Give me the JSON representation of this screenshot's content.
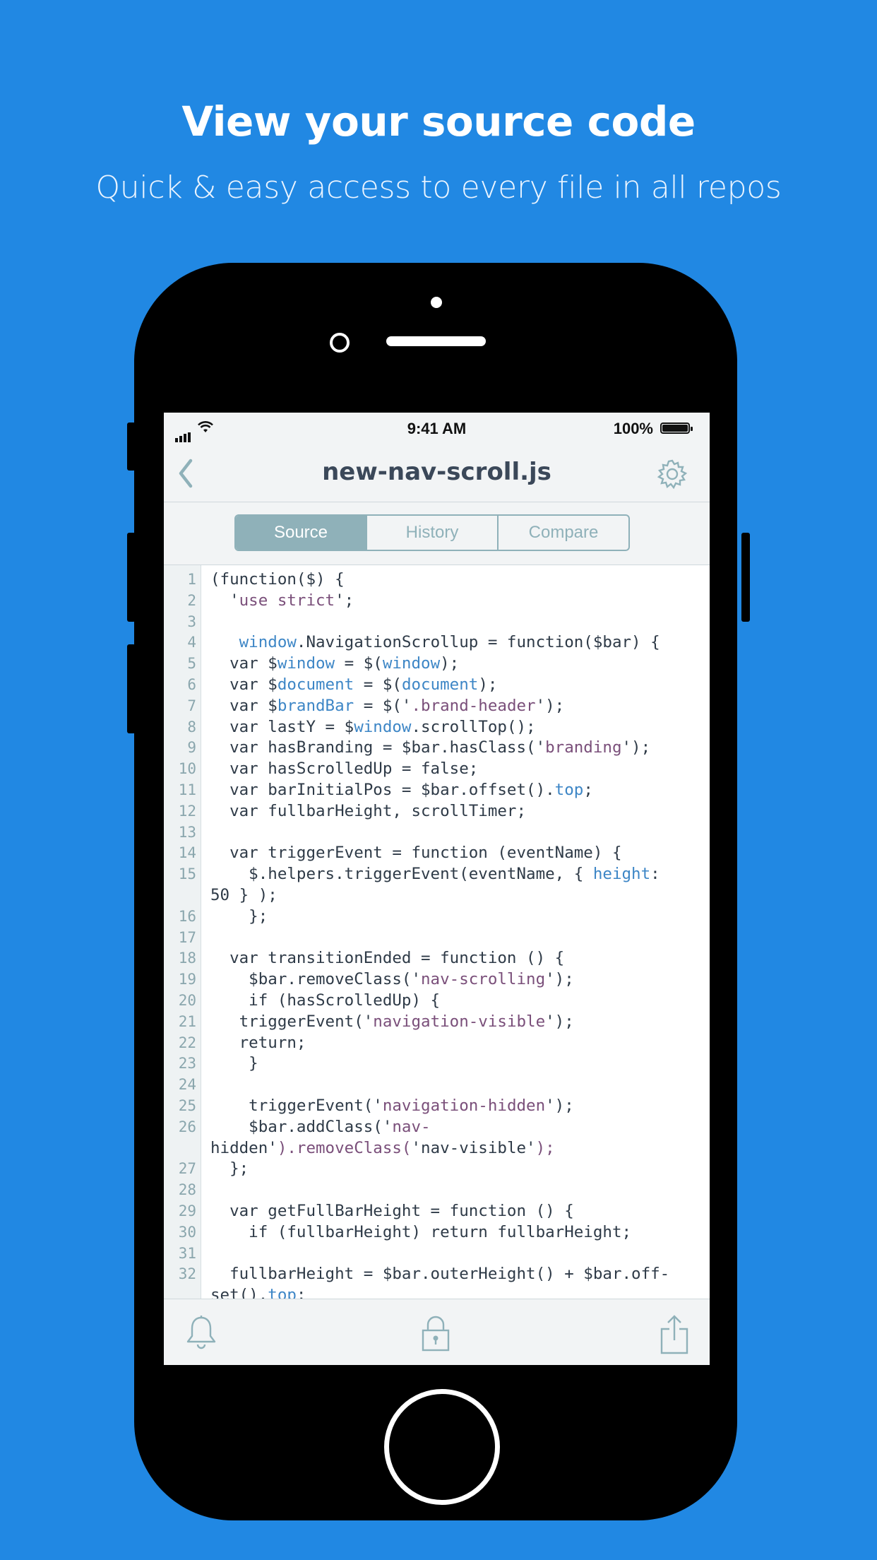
{
  "promo": {
    "headline": "View your source code",
    "subheadline": "Quick & easy access to every file in all repos"
  },
  "status": {
    "time": "9:41 AM",
    "battery": "100%"
  },
  "nav": {
    "title": "new-nav-scroll.js"
  },
  "segments": [
    {
      "label": "Source",
      "active": true
    },
    {
      "label": "History",
      "active": false
    },
    {
      "label": "Compare",
      "active": false
    }
  ],
  "code": [
    {
      "n": "1",
      "text": "(function($) {"
    },
    {
      "n": "2",
      "text": "  'use strict';"
    },
    {
      "n": "3",
      "text": ""
    },
    {
      "n": "4",
      "text": "   window.NavigationScrollup = function($bar) {"
    },
    {
      "n": "5",
      "text": "  var $window = $(window);"
    },
    {
      "n": "6",
      "text": "  var $document = $(document);"
    },
    {
      "n": "7",
      "text": "  var $brandBar = $('.brand-header');"
    },
    {
      "n": "8",
      "text": "  var lastY = $window.scrollTop();"
    },
    {
      "n": "9",
      "text": "  var hasBranding = $bar.hasClass('branding');"
    },
    {
      "n": "10",
      "text": "  var hasScrolledUp = false;"
    },
    {
      "n": "11",
      "text": "  var barInitialPos = $bar.offset().top;"
    },
    {
      "n": "12",
      "text": "  var fullbarHeight, scrollTimer;"
    },
    {
      "n": "13",
      "text": ""
    },
    {
      "n": "14",
      "text": "  var triggerEvent = function (eventName) {"
    },
    {
      "n": "15",
      "text": "    $.helpers.triggerEvent(eventName, { height:\n50 } );"
    },
    {
      "n": "16",
      "text": "    };"
    },
    {
      "n": "17",
      "text": ""
    },
    {
      "n": "18",
      "text": "  var transitionEnded = function () {"
    },
    {
      "n": "19",
      "text": "    $bar.removeClass('nav-scrolling');"
    },
    {
      "n": "20",
      "text": "    if (hasScrolledUp) {"
    },
    {
      "n": "21",
      "text": "   triggerEvent('navigation-visible');"
    },
    {
      "n": "22",
      "text": "   return;"
    },
    {
      "n": "23",
      "text": "    }"
    },
    {
      "n": "24",
      "text": ""
    },
    {
      "n": "25",
      "text": "    triggerEvent('navigation-hidden');"
    },
    {
      "n": "26",
      "text": "    $bar.addClass('nav-\nhidden').removeClass('nav-visible');"
    },
    {
      "n": "27",
      "text": "  };"
    },
    {
      "n": "28",
      "text": ""
    },
    {
      "n": "29",
      "text": "  var getFullBarHeight = function () {"
    },
    {
      "n": "30",
      "text": "    if (fullbarHeight) return fullbarHeight;"
    },
    {
      "n": "31",
      "text": ""
    },
    {
      "n": "32",
      "text": "  fullbarHeight = $bar.outerHeight() + $bar.off-\nset().top;"
    }
  ],
  "tabs": [
    {
      "icon": "bell-icon"
    },
    {
      "icon": "lock-icon"
    },
    {
      "icon": "share-icon"
    }
  ],
  "colors": {
    "background": "#2188e3",
    "accent": "#8fb1b9",
    "keyword_blue": "#3d86c6",
    "string_purple": "#7a4f7a"
  }
}
